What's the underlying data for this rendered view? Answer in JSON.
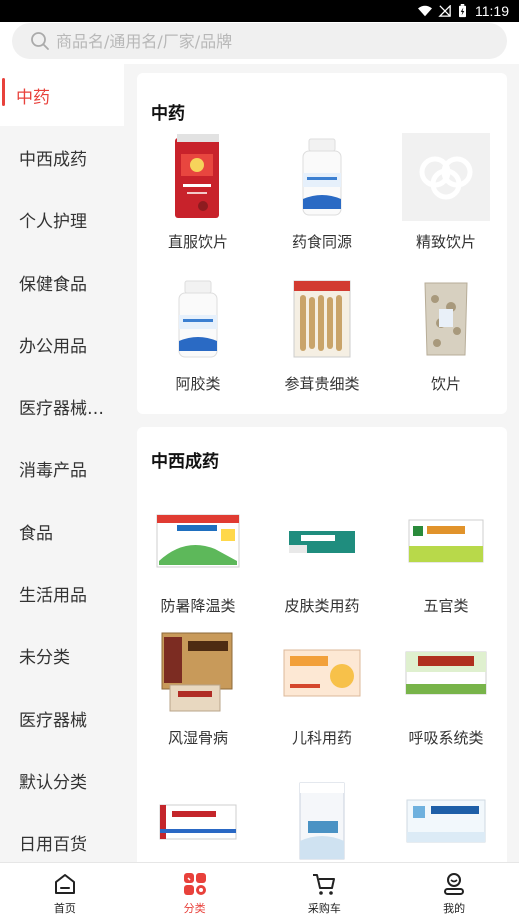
{
  "status_bar": {
    "time": "11:19",
    "icons": [
      "wifi-icon",
      "signal-off-icon",
      "battery-charging-icon"
    ]
  },
  "search": {
    "placeholder": "商品名/通用名/厂家/品牌",
    "icon": "search-icon"
  },
  "sidebar": {
    "active_index": 0,
    "items": [
      {
        "label": "中药"
      },
      {
        "label": "中西成药"
      },
      {
        "label": "个人护理"
      },
      {
        "label": "保健食品"
      },
      {
        "label": "办公用品"
      },
      {
        "label": "医疗器械部..."
      },
      {
        "label": "消毒产品"
      },
      {
        "label": "食品"
      },
      {
        "label": "生活用品"
      },
      {
        "label": "未分类"
      },
      {
        "label": "医疗器械"
      },
      {
        "label": "默认分类"
      },
      {
        "label": "日用百货"
      }
    ]
  },
  "sections": [
    {
      "title": "中药",
      "products": [
        {
          "name": "直服饮片",
          "thumb": "red-box"
        },
        {
          "name": "药食同源",
          "thumb": "white-bottle"
        },
        {
          "name": "精致饮片",
          "thumb": "placeholder-logo"
        },
        {
          "name": "阿胶类",
          "thumb": "white-bottle"
        },
        {
          "name": "参茸贵细类",
          "thumb": "ginseng-pack"
        },
        {
          "name": "饮片",
          "thumb": "herb-bag"
        }
      ]
    },
    {
      "title": "中西成药",
      "products": [
        {
          "name": "防暑降温类",
          "thumb": "box-green"
        },
        {
          "name": "皮肤类用药",
          "thumb": "tube-teal"
        },
        {
          "name": "五官类",
          "thumb": "box-yellow"
        },
        {
          "name": "风湿骨病",
          "thumb": "box-brown"
        },
        {
          "name": "儿科用药",
          "thumb": "box-orange"
        },
        {
          "name": "呼吸系统类",
          "thumb": "box-lightgreen"
        },
        {
          "name": "",
          "thumb": "box-red-strip"
        },
        {
          "name": "",
          "thumb": "box-tall-blue"
        },
        {
          "name": "",
          "thumb": "box-blue-white"
        }
      ]
    }
  ],
  "bottom_nav": [
    {
      "label": "首页",
      "icon": "home-icon"
    },
    {
      "label": "分类",
      "icon": "category-icon"
    },
    {
      "label": "采购车",
      "icon": "cart-icon"
    },
    {
      "label": "我的",
      "icon": "profile-icon"
    }
  ],
  "colors": {
    "accent": "#e8413b",
    "background": "#f5f5f5"
  }
}
